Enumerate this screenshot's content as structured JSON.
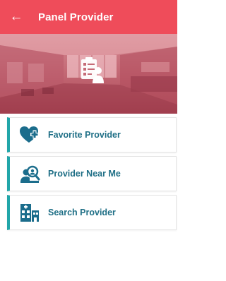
{
  "header": {
    "title": "Panel Provider",
    "back_icon": "arrow-left-icon"
  },
  "banner": {
    "icon": "clipboard-person-icon"
  },
  "menu": {
    "items": [
      {
        "label": "Favorite Provider",
        "icon": "heart-plus-icon"
      },
      {
        "label": "Provider Near Me",
        "icon": "search-person-icon"
      },
      {
        "label": "Search Provider",
        "icon": "hospital-building-icon"
      }
    ]
  },
  "colors": {
    "appbar": "#ef4c5a",
    "accent": "#22a6a9",
    "label": "#1f6f86",
    "icon": "#1b6d8c"
  }
}
